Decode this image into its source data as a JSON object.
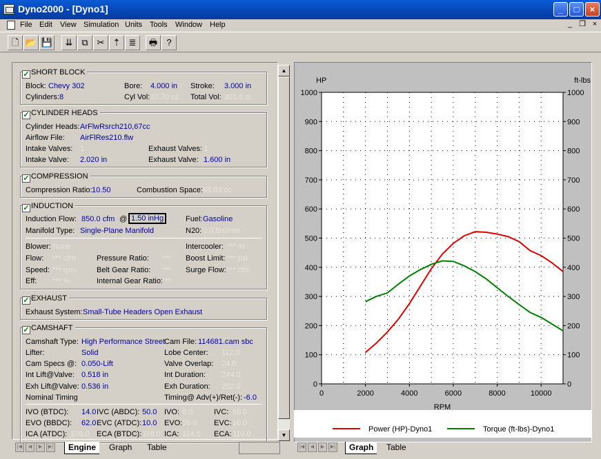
{
  "window": {
    "title": "Dyno2000 - [Dyno1]",
    "min": "_",
    "max": "□",
    "close": "×"
  },
  "menu": [
    "File",
    "Edit",
    "View",
    "Simulation",
    "Units",
    "Tools",
    "Window",
    "Help"
  ],
  "mdi": {
    "min": "_",
    "restore": "❐",
    "close": "×"
  },
  "toolbar": [
    "🗋",
    "📂",
    "💾",
    "⇊",
    "⧉",
    "✂",
    "⇡",
    "≣",
    "🖶",
    "?"
  ],
  "short_block": {
    "title": "SHORT BLOCK",
    "block_label": "Block:",
    "block": "Chevy 302",
    "bore_label": "Bore:",
    "bore": "4.000 in",
    "stroke_label": "Stroke:",
    "stroke": "3.000 in",
    "cyl_label": "Cylinders:",
    "cyl": "8",
    "cylvol_label": "Cyl Vol:",
    "cylvol": "37.70 cc",
    "totvol_label": "Total Vol:",
    "totvol": "301.6 ci"
  },
  "cyl_heads": {
    "title": "CYLINDER HEADS",
    "heads_label": "Cylinder Heads:",
    "heads": "ArFlwRsrch210,67cc",
    "airflow_label": "Airflow File:",
    "airflow": "AirFlRes210.flw",
    "iv_label": "Intake Valves:",
    "iv": "1",
    "ev_label": "Exhaust Valves:",
    "ev": "1",
    "ivs_label": "Intake Valve:",
    "ivs": "2.020 in",
    "evs_label": "Exhaust Valve:",
    "evs": "1.600 in"
  },
  "compression": {
    "title": "COMPRESSION",
    "cr_label": "Compression Ratio:",
    "cr": "10.50",
    "cs_label": "Combustion Space:",
    "cs": "65.03 cc"
  },
  "induction": {
    "title": "INDUCTION",
    "flow_label": "Induction Flow:",
    "flow": "850.0 cfm",
    "at": "@",
    "vac": "1.50 inHg",
    "fuel_label": "Fuel:",
    "fuel": "Gasoline",
    "man_label": "Manifold Type:",
    "man": "Single-Plane Manifold",
    "n2o_label": "N20:",
    "n2o": "0.0 lbs/min",
    "blower_label": "Blower:",
    "blower": "None",
    "ic_label": "Intercooler:",
    "ic": "*** %",
    "flow2_label": "Flow:",
    "flow2": "*** cfm",
    "pr_label": "Pressure Ratio:",
    "pr": "***",
    "bl_label": "Boost Limit:",
    "bl": "*** psi",
    "speed_label": "Speed:",
    "speed": "*** rpm",
    "bg_label": "Belt Gear Ratio:",
    "bg": "***",
    "sf_label": "Surge Flow:",
    "sf": "*** cfm",
    "eff_label": "Eff:",
    "eff": "*** %",
    "ig_label": "Internal Gear Ratio:",
    "ig": "***"
  },
  "exhaust": {
    "title": "EXHAUST",
    "sys_label": "Exhaust System:",
    "sys": "Small-Tube Headers Open Exhaust"
  },
  "camshaft": {
    "title": "CAMSHAFT",
    "type_label": "Camshaft Type:",
    "type": "High Performance Street",
    "file_label": "Cam File:",
    "file": "114681.cam sbc",
    "lifter_label": "Lifter:",
    "lifter": "Solid",
    "lc_label": "Lobe Center:",
    "lc": "112.0",
    "specs_label": "Cam Specs @:",
    "specs": "0.050-Lift",
    "vo_label": "Valve Overlap:",
    "vo": "24.0",
    "il_label": "Int Lift@Valve:",
    "il": "0.518 in",
    "id_label": "Int Duration:",
    "id": "244.0",
    "el_label": "Exh Lift@Valve:",
    "el": "0.536 in",
    "ed_label": "Exh Duration:",
    "ed": "252.0",
    "nt_label": "Nominal Timing",
    "ta_label": "Timing@ Adv(+)/Ret(-):",
    "ta": "-6.0",
    "ivo_label": "IVO (BTDC):",
    "ivo": "14.0",
    "ivc_label": "IVC (ABDC):",
    "ivc": "50.0",
    "ivo2_label": "IVO:",
    "ivo2": "8.0",
    "ivc2_label": "IVC:",
    "ivc2": "56.0",
    "evo_label": "EVO (BBDC):",
    "evo": "62.0",
    "evc_label": "EVC (ATDC):",
    "evc": "10.0",
    "evo2_label": "EVO:",
    "evo2": "56.0",
    "evc2_label": "EVC:",
    "evc2": "16.0",
    "ica_label": "ICA  (ATDC):",
    "ica": "108.0",
    "eca_label": "ECA (BTDC):",
    "eca": "116.0",
    "ica2_label": "ICA:",
    "ica2": "114.0",
    "eca2_label": "ECA:",
    "eca2": "110.0"
  },
  "left_tabs": [
    "Engine",
    "Graph",
    "Table"
  ],
  "right_tabs": [
    "Graph",
    "Table"
  ],
  "colors": {
    "power": "#e00000",
    "torque": "#008000"
  },
  "chart_data": {
    "type": "line",
    "xlabel": "RPM",
    "ylabel": "HP",
    "ylabel_right": "ft-lbs",
    "xlim": [
      0,
      11000
    ],
    "ylim": [
      0,
      1000
    ],
    "x_ticks": [
      "0",
      "2000",
      "4000",
      "6000",
      "8000",
      "10000"
    ],
    "y_ticks": [
      "0",
      "100",
      "200",
      "300",
      "400",
      "500",
      "600",
      "700",
      "800",
      "900",
      "1000"
    ],
    "grid": true,
    "legend": "bottom",
    "series": [
      {
        "name": "Power (HP)-Dyno1",
        "x": [
          2000,
          2500,
          3000,
          3500,
          4000,
          4500,
          5000,
          5500,
          6000,
          6500,
          7000,
          7500,
          8000,
          8500,
          9000,
          9500,
          10000,
          10500,
          11000
        ],
        "values": [
          108,
          140,
          178,
          222,
          275,
          335,
          395,
          445,
          482,
          508,
          522,
          520,
          514,
          505,
          488,
          457,
          440,
          415,
          385
        ]
      },
      {
        "name": "Torque (ft-lbs)-Dyno1",
        "x": [
          2000,
          2500,
          3000,
          3500,
          4000,
          4500,
          5000,
          5500,
          6000,
          6500,
          7000,
          7500,
          8000,
          8500,
          9000,
          9500,
          10000,
          10500,
          11000
        ],
        "values": [
          282,
          300,
          312,
          342,
          370,
          392,
          410,
          422,
          420,
          405,
          385,
          360,
          330,
          300,
          272,
          245,
          228,
          205,
          182
        ]
      }
    ]
  }
}
